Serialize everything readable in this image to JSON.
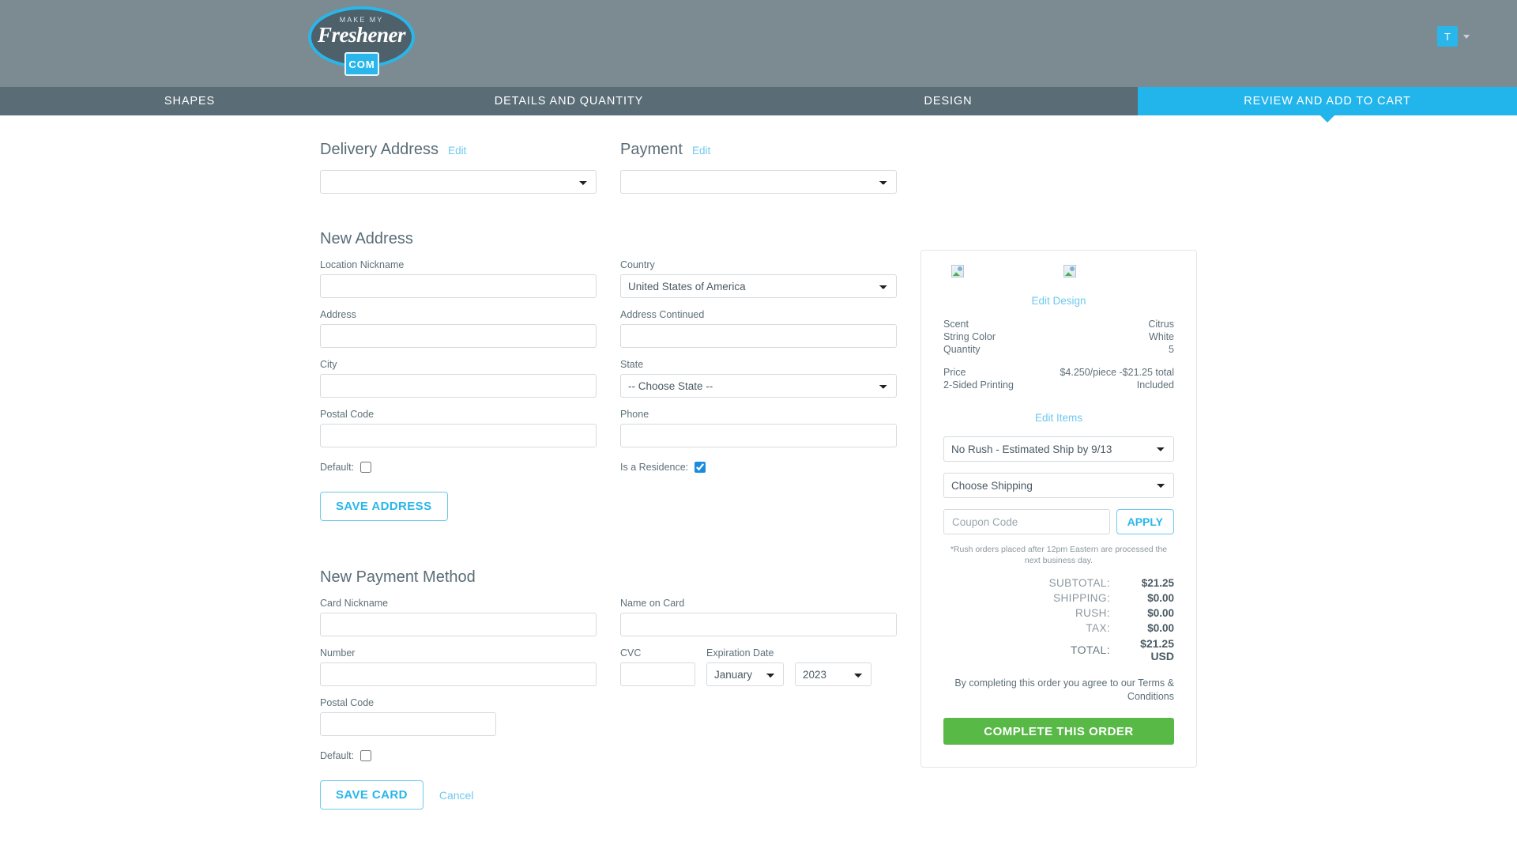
{
  "header": {
    "logo": {
      "line1": "MAKE MY",
      "line2": "Freshener",
      "line3": "COM"
    },
    "avatar_initial": "T"
  },
  "nav": {
    "items": [
      {
        "label": "SHAPES",
        "active": false
      },
      {
        "label": "DETAILS AND QUANTITY",
        "active": false
      },
      {
        "label": "DESIGN",
        "active": false
      },
      {
        "label": "REVIEW AND ADD TO CART",
        "active": true
      }
    ]
  },
  "delivery_address": {
    "title": "Delivery Address",
    "edit_label": "Edit",
    "select_value": ""
  },
  "payment": {
    "title": "Payment",
    "edit_label": "Edit",
    "select_value": ""
  },
  "new_address": {
    "title": "New Address",
    "fields": {
      "location_nickname_label": "Location Nickname",
      "location_nickname_value": "",
      "country_label": "Country",
      "country_value": "United States of America",
      "address_label": "Address",
      "address_value": "",
      "address_continued_label": "Address Continued",
      "address_continued_value": "",
      "city_label": "City",
      "city_value": "",
      "state_label": "State",
      "state_value": "-- Choose State --",
      "postal_code_label": "Postal Code",
      "postal_code_value": "",
      "phone_label": "Phone",
      "phone_value": ""
    },
    "default_label": "Default:",
    "default_checked": false,
    "residence_label": "Is a Residence:",
    "residence_checked": true,
    "save_button": "SAVE ADDRESS"
  },
  "new_payment": {
    "title": "New Payment Method",
    "fields": {
      "card_nickname_label": "Card Nickname",
      "card_nickname_value": "",
      "name_on_card_label": "Name on Card",
      "name_on_card_value": "",
      "number_label": "Number",
      "number_value": "",
      "cvc_label": "CVC",
      "cvc_value": "",
      "expiration_label": "Expiration Date",
      "expiration_month": "January",
      "expiration_year": "2023",
      "postal_code_label": "Postal Code",
      "postal_code_value": ""
    },
    "default_label": "Default:",
    "default_checked": false,
    "save_button": "SAVE CARD",
    "cancel_label": "Cancel"
  },
  "summary": {
    "edit_design_label": "Edit Design",
    "attributes": [
      {
        "key": "Scent",
        "value": "Citrus"
      },
      {
        "key": "String Color",
        "value": "White"
      },
      {
        "key": "Quantity",
        "value": "5"
      }
    ],
    "pricing": [
      {
        "key": "Price",
        "value": "$4.250/piece -$21.25 total"
      },
      {
        "key": "2-Sided Printing",
        "value": "Included"
      }
    ],
    "edit_items_label": "Edit Items",
    "rush_select_value": "No Rush - Estimated Ship by 9/13",
    "shipping_select_value": "Choose Shipping",
    "coupon_placeholder": "Coupon Code",
    "coupon_value": "",
    "apply_label": "APPLY",
    "rush_note": "*Rush orders placed after 12pm Eastern are processed the next business day.",
    "totals": [
      {
        "key": "SUBTOTAL:",
        "value": "$21.25"
      },
      {
        "key": "SHIPPING:",
        "value": "$0.00"
      },
      {
        "key": "RUSH:",
        "value": "$0.00"
      },
      {
        "key": "TAX:",
        "value": "$0.00"
      }
    ],
    "grand_total": {
      "key": "TOTAL:",
      "value": "$21.25 USD"
    },
    "terms": "By completing this order you agree to our Terms & Conditions",
    "complete_label": "COMPLETE THIS ORDER"
  },
  "colors": {
    "brand_blue": "#29b6ea",
    "header_gray": "#7c8b92",
    "nav_gray": "#5a6c76",
    "green": "#58b947"
  }
}
